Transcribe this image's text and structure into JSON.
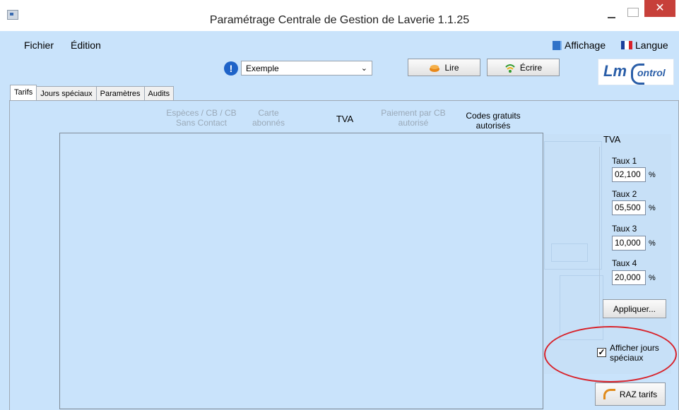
{
  "window": {
    "title": "Paramétrage Centrale de Gestion de Laverie 1.1.25",
    "close_glyph": "✕"
  },
  "menu": {
    "fichier": "Fichier",
    "edition": "Édition",
    "affichage": "Affichage",
    "langue": "Langue"
  },
  "toolbar": {
    "warning_glyph": "!",
    "selected_profile": "Exemple",
    "read_label": "Lire",
    "write_label": "Écrire"
  },
  "logo": {
    "lm": "Lm",
    "ontrol": "ontrol"
  },
  "tabs": [
    "Tarifs",
    "Jours spéciaux",
    "Paramètres",
    "Audits"
  ],
  "columns": {
    "especes": [
      "Espèces / CB / CB",
      "Sans Contact"
    ],
    "carte": [
      "Carte",
      "abonnés"
    ],
    "tva": "TVA",
    "paiement": [
      "Paiement par CB",
      "autorisé"
    ],
    "codes": [
      "Codes gratuits",
      "autorisés"
    ]
  },
  "tva_panel": {
    "title": "TVA",
    "rates": [
      {
        "label": "Taux 1",
        "value": "02,100"
      },
      {
        "label": "Taux 2",
        "value": "05,500"
      },
      {
        "label": "Taux 3",
        "value": "10,000"
      },
      {
        "label": "Taux 4",
        "value": "20,000"
      }
    ],
    "percent_sign": "%",
    "apply_label": "Appliquer..."
  },
  "options": {
    "show_special_days": "Afficher jours spéciaux",
    "show_special_days_checked": true
  },
  "raz_label": "RAZ tarifs",
  "colors": {
    "window_bg": "#c9e3fb",
    "close_red": "#c7403a",
    "annotation_red": "#d8222a",
    "brand_blue": "#2a5ea8"
  }
}
